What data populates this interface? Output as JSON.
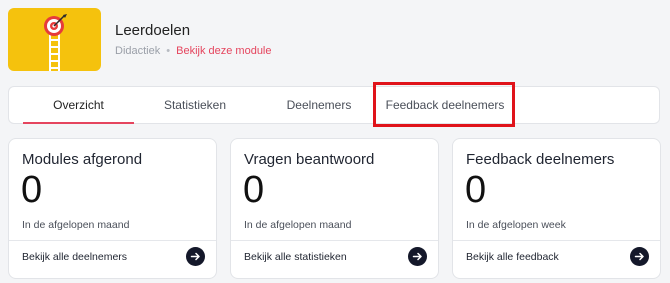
{
  "module": {
    "title": "Leerdoelen",
    "category": "Didactiek",
    "separator": "•",
    "link": "Bekijk deze module"
  },
  "tabs": [
    {
      "label": "Overzicht",
      "active": true
    },
    {
      "label": "Statistieken",
      "active": false
    },
    {
      "label": "Deelnemers",
      "active": false
    },
    {
      "label": "Feedback deelnemers",
      "active": false
    }
  ],
  "cards": [
    {
      "title": "Modules afgerond",
      "value": "0",
      "period": "In de afgelopen maand",
      "footer": "Bekijk alle deelnemers"
    },
    {
      "title": "Vragen beantwoord",
      "value": "0",
      "period": "In de afgelopen maand",
      "footer": "Bekijk alle statistieken"
    },
    {
      "title": "Feedback deelnemers",
      "value": "0",
      "period": "In de afgelopen week",
      "footer": "Bekijk alle feedback"
    }
  ],
  "icons": {
    "module_thumbnail": "target-ladder-illustration",
    "card_action": "arrow-right-icon"
  },
  "colors": {
    "accent": "#e5455e",
    "highlight_box": "#e0131a",
    "thumbnail_bg": "#f5c20d",
    "action_button": "#14182a"
  }
}
